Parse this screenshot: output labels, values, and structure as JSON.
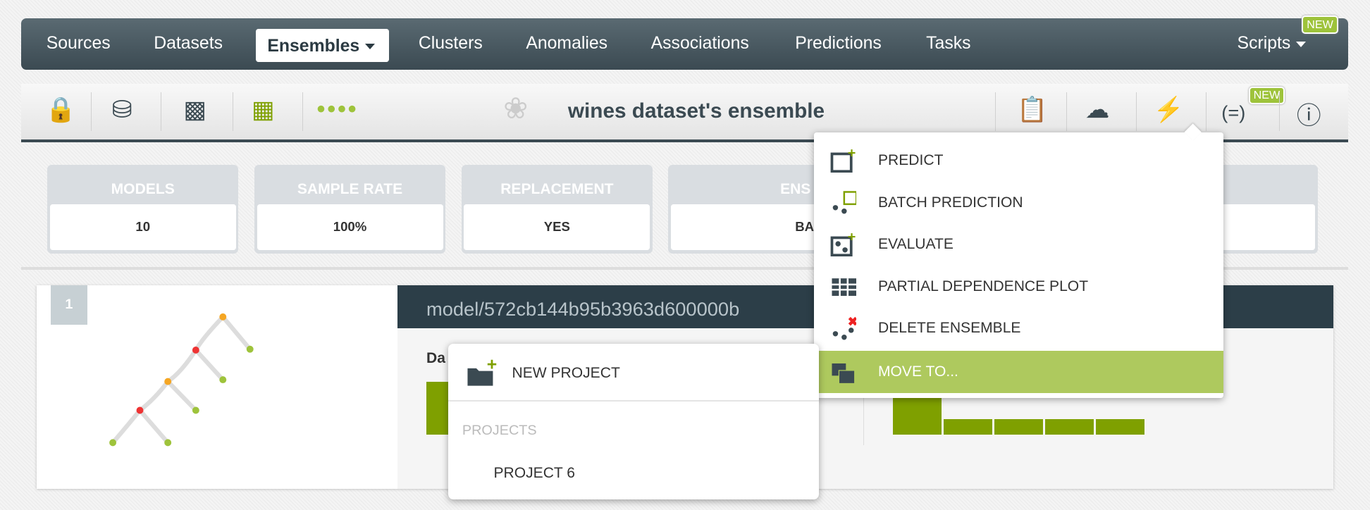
{
  "nav": {
    "items": [
      "Sources",
      "Datasets",
      "Ensembles",
      "Clusters",
      "Anomalies",
      "Associations",
      "Predictions",
      "Tasks"
    ],
    "active": "Ensembles",
    "scripts": "Scripts",
    "new_badge": "NEW"
  },
  "toolbar": {
    "title": "wines dataset's ensemble",
    "new_badge": "NEW"
  },
  "cards": [
    {
      "label": "MODELS",
      "value": "10"
    },
    {
      "label": "SAMPLE RATE",
      "value": "100%"
    },
    {
      "label": "REPLACEMENT",
      "value": "YES"
    },
    {
      "label": "ENS",
      "value": "BA"
    }
  ],
  "model": {
    "index": "1",
    "id": "model/572cb144b95b3963d600000b",
    "section": "Da"
  },
  "actions_menu": {
    "items": [
      "PREDICT",
      "BATCH PREDICTION",
      "EVALUATE",
      "PARTIAL DEPENDENCE PLOT",
      "DELETE ENSEMBLE",
      "MOVE TO..."
    ],
    "highlighted": "MOVE TO..."
  },
  "move_menu": {
    "new_project": "NEW PROJECT",
    "projects_header": "PROJECTS",
    "projects": [
      "PROJECT 6"
    ]
  },
  "colors": {
    "nav": "#3b4a52",
    "accent": "#9ec33b",
    "highlight": "#aec95e",
    "bar": "#7fa000"
  }
}
